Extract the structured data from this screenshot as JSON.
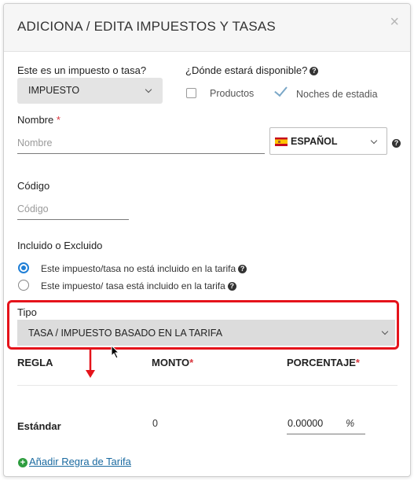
{
  "header": {
    "title": "ADICIONA / EDITA IMPUESTOS Y TASAS",
    "close_symbol": "×"
  },
  "tipo_impuesto": {
    "label": "Este es un impuesto o tasa?",
    "selected": "IMPUESTO"
  },
  "disponible": {
    "label": "¿Dónde estará disponible?",
    "options": [
      {
        "label": "Productos",
        "checked": false
      },
      {
        "label": "Noches de estadia",
        "checked": true
      }
    ]
  },
  "nombre": {
    "label": "Nombre",
    "required_mark": "*",
    "placeholder": "Nombre",
    "value": ""
  },
  "idioma": {
    "selected": "ESPAÑOL"
  },
  "codigo": {
    "label": "Código",
    "placeholder": "Código",
    "value": ""
  },
  "incluido": {
    "label": "Incluido o Excluido",
    "options": [
      {
        "label": "Este impuesto/tasa no está incluido en la tarifa",
        "selected": true
      },
      {
        "label": "Este impuesto/ tasa está incluido en la tarifa",
        "selected": false
      }
    ]
  },
  "tipo": {
    "label": "Tipo",
    "selected": "TASA / IMPUESTO BASADO EN LA TARIFA"
  },
  "table": {
    "columns": [
      "REGLA",
      "MONTO",
      "PORCENTAJE"
    ],
    "required_mark": "*",
    "row": {
      "regla": "Estándar",
      "monto": "0",
      "porcentaje": "0.00000",
      "unit": "%"
    }
  },
  "add_rule_link": "Añadir Regra de Tarifa",
  "help_symbol": "?",
  "plus_symbol": "+",
  "colors": {
    "highlight": "#e5131b",
    "radio_accent": "#1f7fd6",
    "link": "#1a6aa0",
    "required": "#d9363e"
  }
}
